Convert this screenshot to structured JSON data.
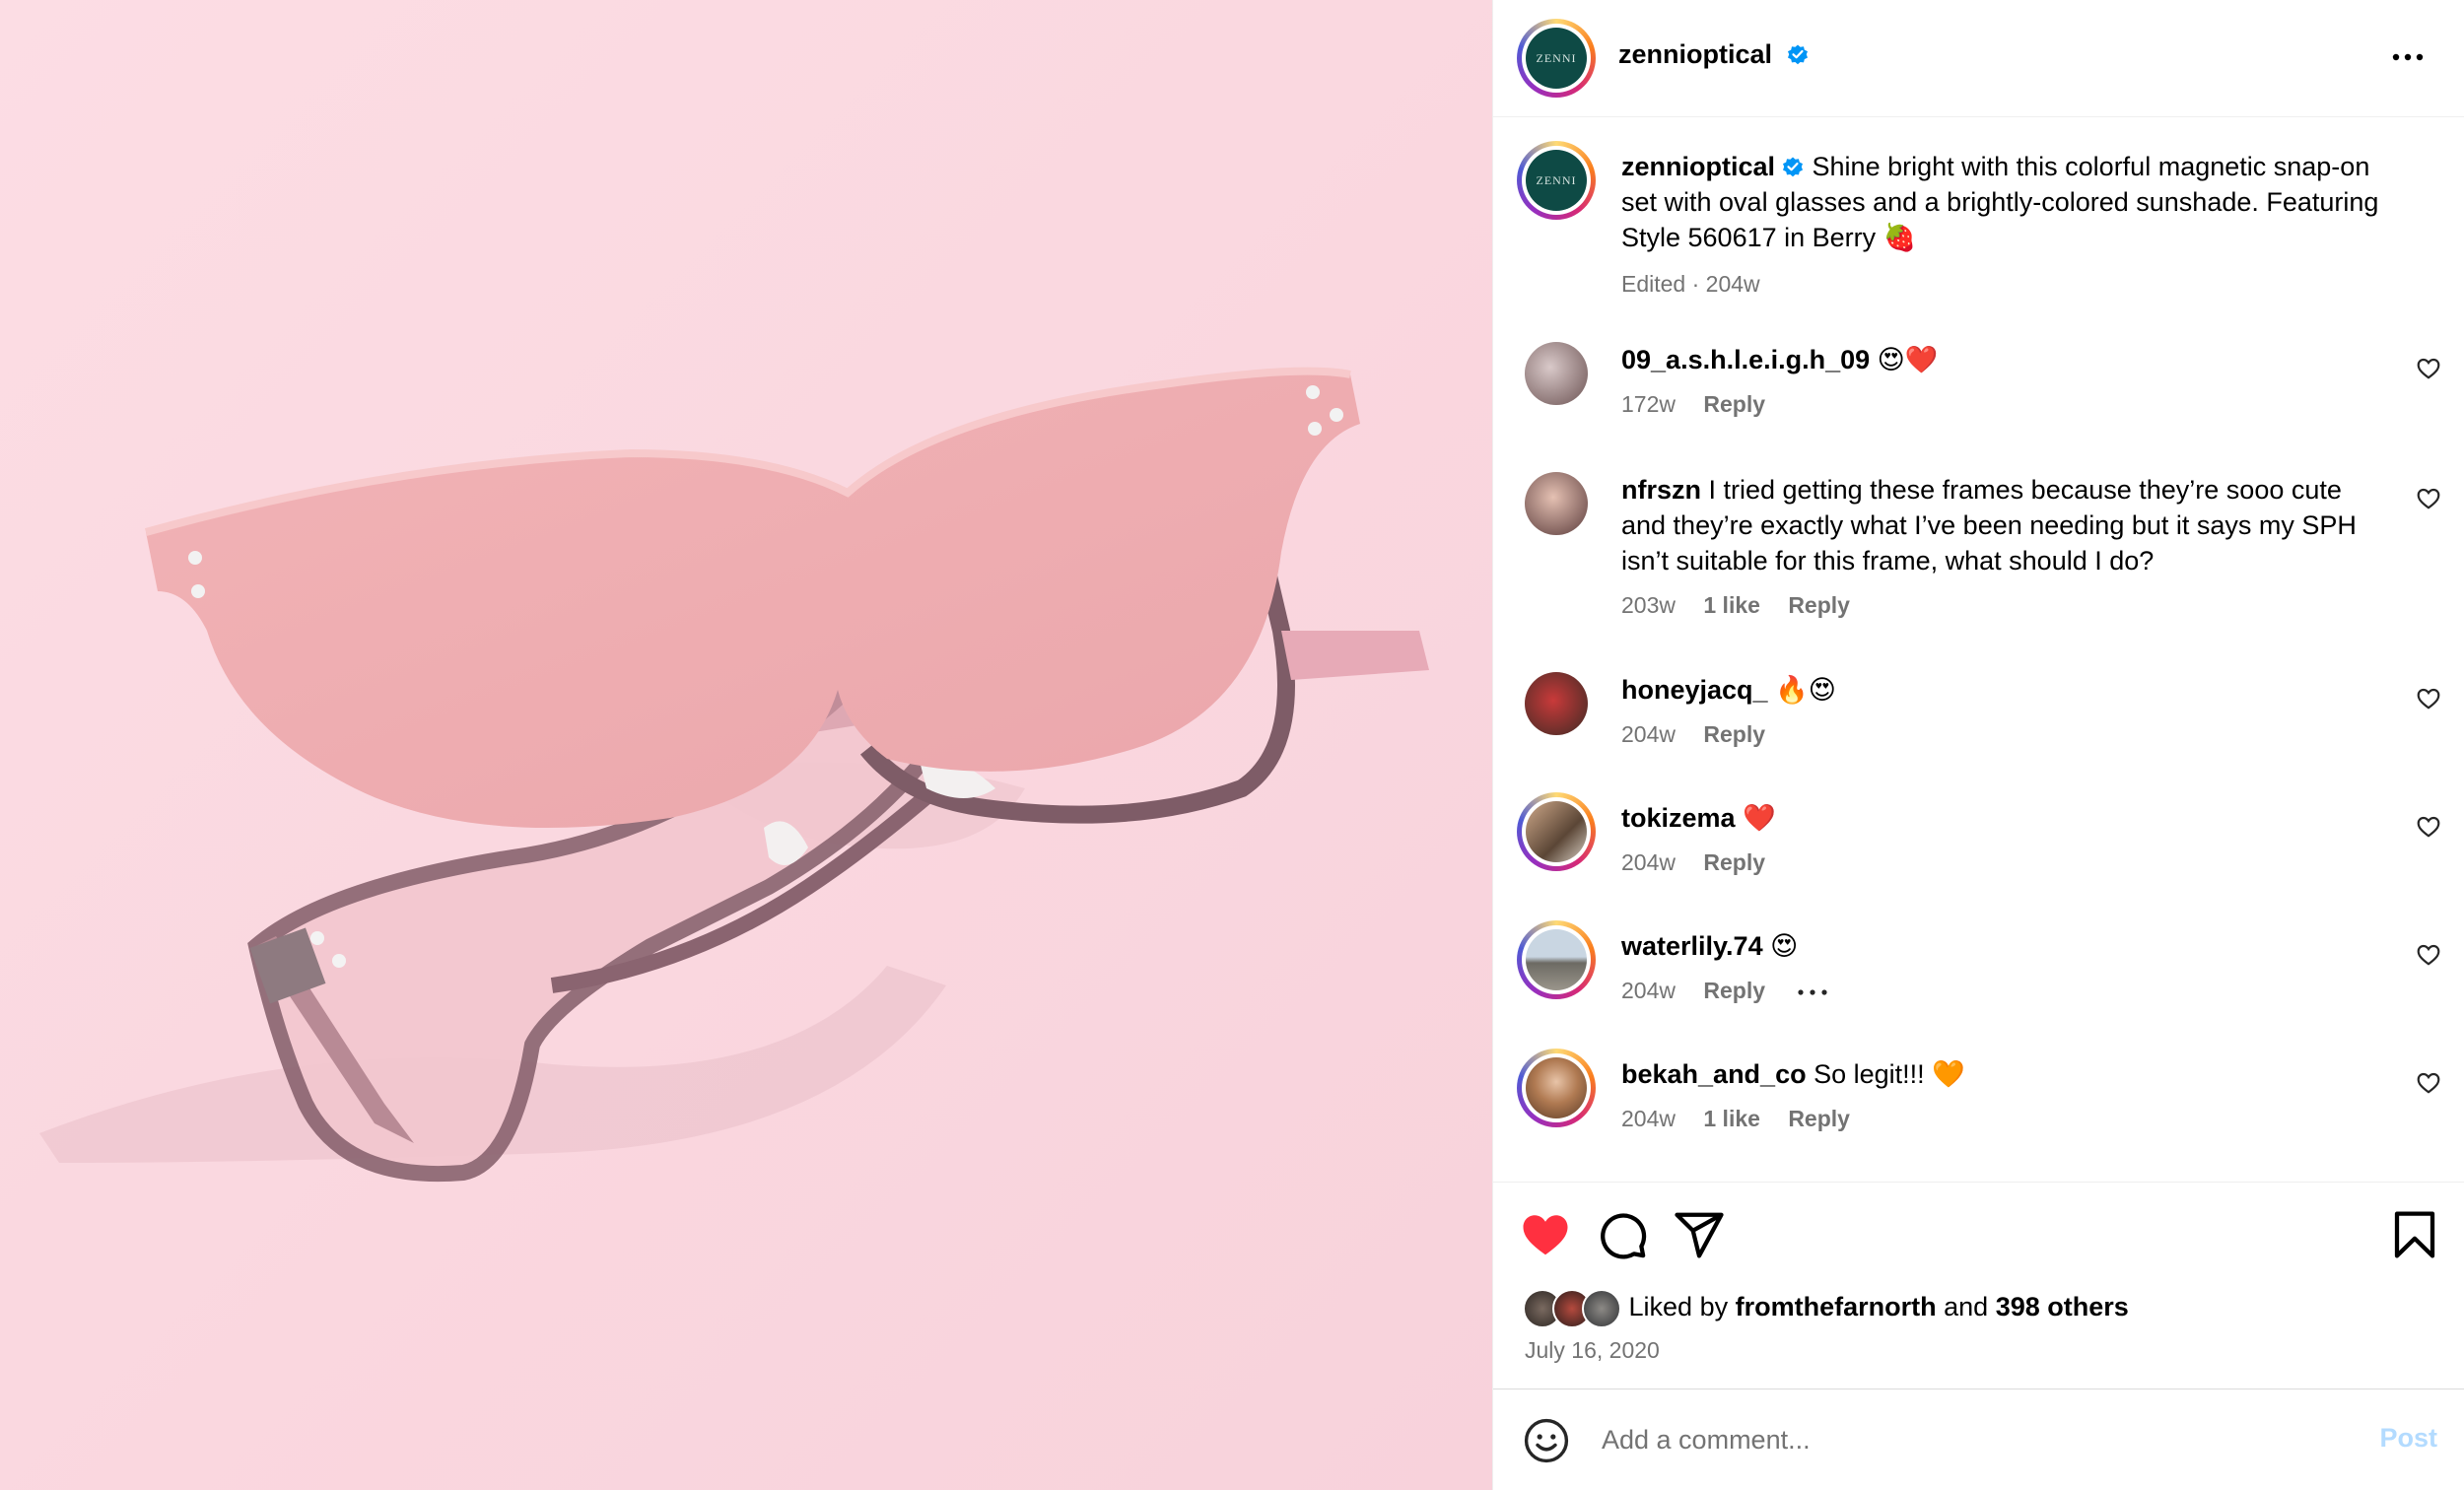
{
  "post": {
    "author": "zennioptical",
    "avatar_text": "ZENNI",
    "verified": true
  },
  "caption": {
    "author": "zennioptical",
    "text": "Shine bright with this colorful magnetic snap-on set with oval glasses and a brightly-colored sunshade. Featuring Style 560617 in Berry 🍓",
    "meta": "Edited · 204w"
  },
  "comments": [
    {
      "user": "09_a.s.h.l.e.i.g.h_09",
      "text": "😍❤️",
      "age": "172w",
      "likes": "",
      "reply": "Reply"
    },
    {
      "user": "nfrszn",
      "text": "I tried getting these frames because they’re sooo cute and they’re exactly what I’ve been needing but it says my SPH isn’t suitable for this frame, what should I do?",
      "age": "203w",
      "likes": "1 like",
      "reply": "Reply"
    },
    {
      "user": "honeyjacq_",
      "text": "🔥😍",
      "age": "204w",
      "likes": "",
      "reply": "Reply"
    },
    {
      "user": "tokizema",
      "text": "❤️",
      "age": "204w",
      "likes": "",
      "reply": "Reply"
    },
    {
      "user": "waterlily.74",
      "text": "😍",
      "age": "204w",
      "likes": "",
      "reply": "Reply"
    },
    {
      "user": "bekah_and_co",
      "text": "So legit!!! 🧡",
      "age": "204w",
      "likes": "1 like",
      "reply": "Reply"
    }
  ],
  "likes": {
    "prefix": "Liked by",
    "user": "fromthefarnorth",
    "joiner": "and",
    "others": "398 others"
  },
  "date": "July 16, 2020",
  "add_comment": {
    "placeholder": "Add a comment...",
    "post_label": "Post"
  },
  "colors": {
    "background_photo": "#fad9e1",
    "like_red": "#ff3040",
    "verified_blue": "#0095f6",
    "post_disabled": "#b3dbff",
    "muted_text": "#737373"
  },
  "icons": [
    "more-options-icon",
    "verified-badge-icon",
    "heart-icon",
    "comment-icon",
    "share-icon",
    "bookmark-icon",
    "emoji-icon"
  ]
}
